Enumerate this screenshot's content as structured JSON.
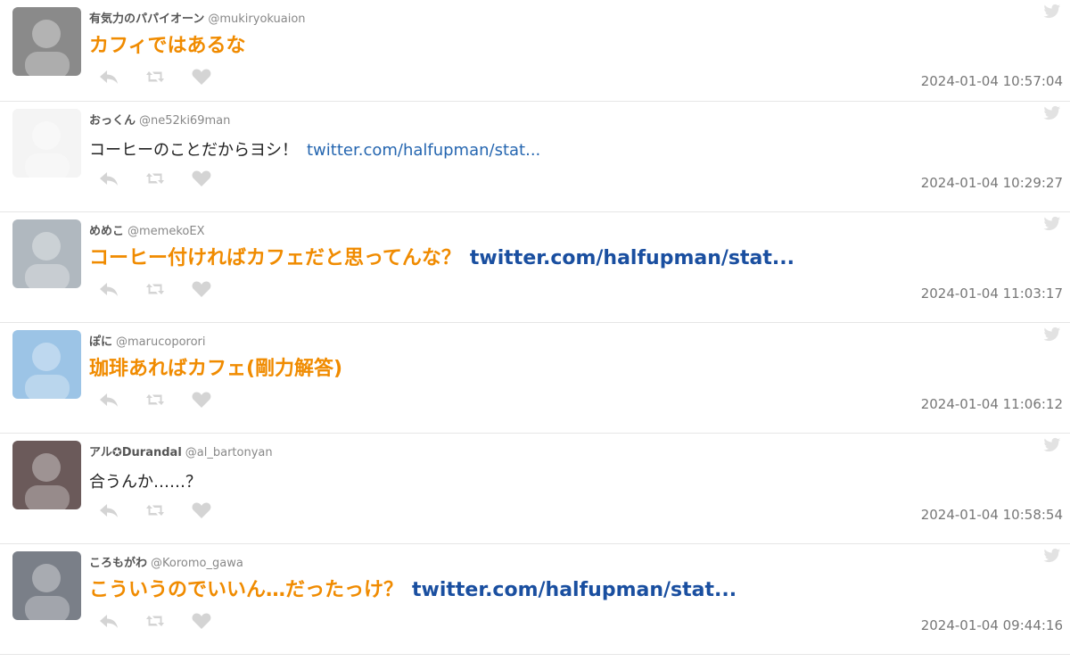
{
  "tweets": [
    {
      "name": "有気力のパパイオーン",
      "handle": "@mukiryokuaion",
      "text": "カフィではあるな",
      "link": "",
      "style": "big",
      "time": "2024-01-04 10:57:04",
      "avatar_bg": "#8a8a8a"
    },
    {
      "name": "おっくん",
      "handle": "@ne52ki69man",
      "text": "コーヒーのことだからヨシ！",
      "link": "twitter.com/halfupman/stat...",
      "style": "normal",
      "time": "2024-01-04 10:29:27",
      "avatar_bg": "#f4f4f4"
    },
    {
      "name": "めめこ",
      "handle": "@memekoEX",
      "text": "コーヒー付ければカフェだと思ってんな？",
      "link": "twitter.com/halfupman/stat...",
      "style": "big",
      "time": "2024-01-04 11:03:17",
      "avatar_bg": "#b0b8bf"
    },
    {
      "name": "ぽに",
      "handle": "@marucopororі",
      "text": "珈琲あればカフェ(剛力解答)",
      "link": "",
      "style": "big",
      "time": "2024-01-04 11:06:12",
      "avatar_bg": "#9cc4e6"
    },
    {
      "name": "アル✪Durandal",
      "handle": "@al_bartonyan",
      "text": "合うんか……？",
      "link": "",
      "style": "normal",
      "time": "2024-01-04 10:58:54",
      "avatar_bg": "#6b5a5a"
    },
    {
      "name": "ころもがわ",
      "handle": "@Koromo_gawa",
      "text": "こういうのでいいん…だったっけ？",
      "link": "twitter.com/halfupman/stat...",
      "style": "big",
      "time": "2024-01-04 09:44:16",
      "avatar_bg": "#7a7f88"
    }
  ],
  "icons": {
    "reply": "reply-icon",
    "retweet": "retweet-icon",
    "like": "heart-icon",
    "bird": "twitter-bird-icon"
  }
}
